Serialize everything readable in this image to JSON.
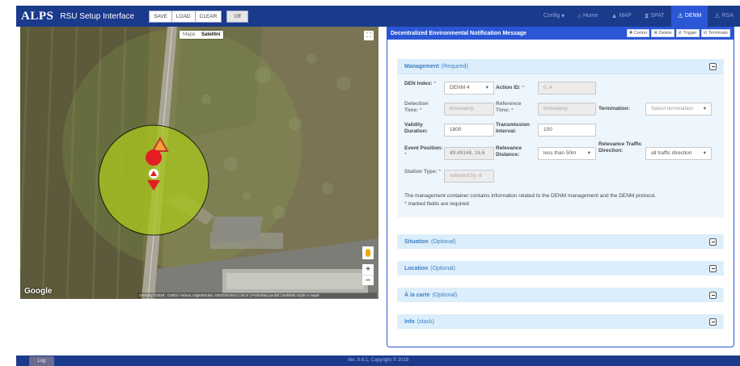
{
  "header": {
    "logo": "ALPS",
    "title": "RSU Setup Interface",
    "buttons": [
      "SAVE",
      "LOAD",
      "CLEAR"
    ],
    "toggle": "Off",
    "nav": [
      {
        "label": "Config",
        "icon": "chevron-down-icon",
        "active": false
      },
      {
        "label": "Home",
        "icon": "home-icon",
        "active": false
      },
      {
        "label": "MAP",
        "icon": "map-icon",
        "active": false
      },
      {
        "label": "SPAT",
        "icon": "hourglass-icon",
        "active": false
      },
      {
        "label": "DENM",
        "icon": "warning-icon",
        "active": true
      },
      {
        "label": "RSA",
        "icon": "warning-icon",
        "active": false
      }
    ]
  },
  "map": {
    "type_options": [
      "Mapa",
      "Satelitní"
    ],
    "selected_type": "Satelitní",
    "zoom_in": "+",
    "zoom_out": "−",
    "logo": "Google",
    "attribution": "Obrázky ©2018 , CNES / Airbus, DigitalGlobe, GEODIS Brno | 20 m | Podmínky použití | Nahlásit chybu v mapě"
  },
  "panel": {
    "title": "Decentralized Environmental Notification Message",
    "actions": [
      "Center",
      "Delete",
      "Trigger",
      "Terminate"
    ],
    "management": {
      "name": "Management",
      "tag": "(Required)",
      "den_index_label": "DEN Index:",
      "den_index_value": "DENM 4",
      "action_id_label": "Action ID:",
      "action_id_value": "0, 4",
      "detection_time_label": "Detection Time:",
      "detection_time_placeholder": "timestamp",
      "reference_time_label": "Reference Time:",
      "reference_time_placeholder": "timestamp",
      "termination_label": "Termination:",
      "termination_placeholder": "Select termination",
      "validity_label": "Validity Duration:",
      "validity_value": "1800",
      "transmission_label": "Transmission Interval:",
      "transmission_value": "100",
      "event_position_label": "Event Position:",
      "event_position_value": "49.49148, 16.6",
      "relevance_distance_label": "Relevance Distance:",
      "relevance_distance_value": "less than 50m",
      "relevance_direction_label": "Relevance Traffic Direction:",
      "relevance_direction_value": "all traffic direction",
      "station_type_label": "Station Type:",
      "station_type_placeholder": "selected by st",
      "required_mark": "*",
      "note_line1": "The management container contains information related to the DENM management and the DENM protocol.",
      "note_line2": "* marked fields are required"
    },
    "sections": [
      {
        "name": "Situation",
        "tag": "(Optional)"
      },
      {
        "name": "Location",
        "tag": "(Optional)"
      },
      {
        "name": "À la carte",
        "tag": "(Optional)"
      },
      {
        "name": "Info",
        "tag": "(stack)"
      }
    ]
  },
  "footer": {
    "log_button": "Log",
    "version": "Ver. 0.6.1, Copyright © 2018"
  }
}
